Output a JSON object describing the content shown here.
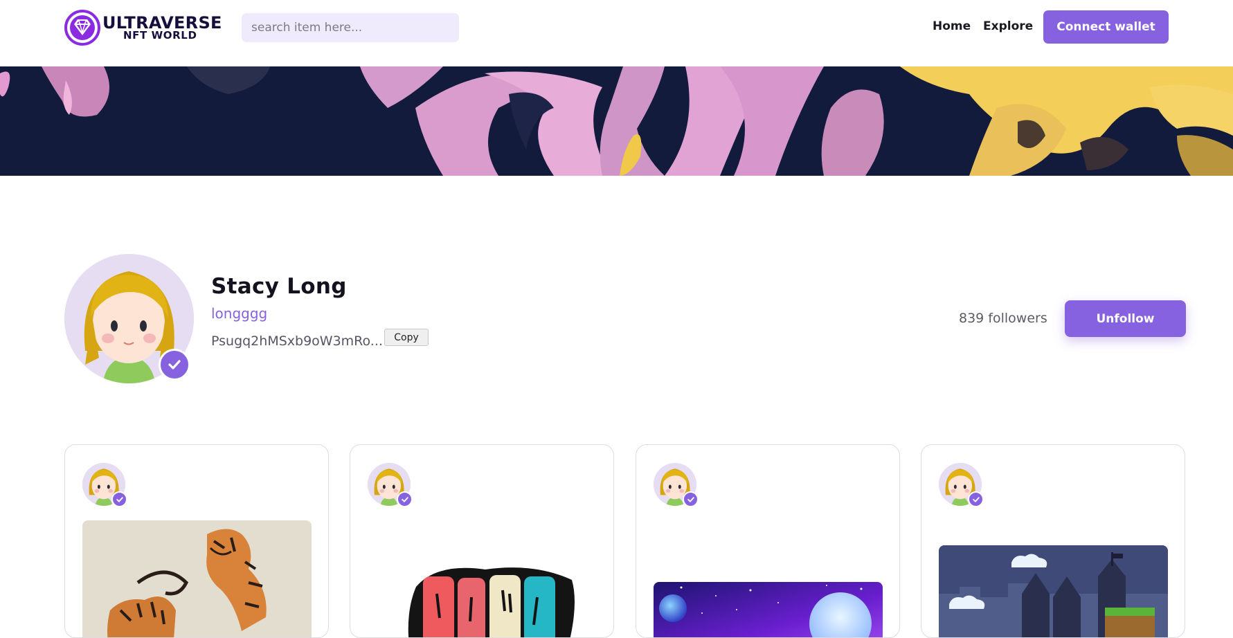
{
  "header": {
    "logo_line1": "ULTRAVERSE",
    "logo_line2": "NFT WORLD",
    "search_placeholder": "search item here...",
    "nav": {
      "home": "Home",
      "explore": "Explore"
    },
    "connect_label": "Connect wallet"
  },
  "colors": {
    "accent": "#8661e0",
    "search_bg": "#efeafc",
    "banner_bg": "#121a3a"
  },
  "profile": {
    "name": "Stacy Long",
    "handle": "longggg",
    "address": "Psugq2hMSxb9oW3mRo...",
    "copy_label": "Copy",
    "followers": "839 followers",
    "unfollow_label": "Unfollow",
    "verified": true
  },
  "cards": [
    {
      "image": "tigers-artwork"
    },
    {
      "image": "graffiti-letters-artwork"
    },
    {
      "image": "space-planets-artwork"
    },
    {
      "image": "pixel-castle-artwork"
    }
  ]
}
